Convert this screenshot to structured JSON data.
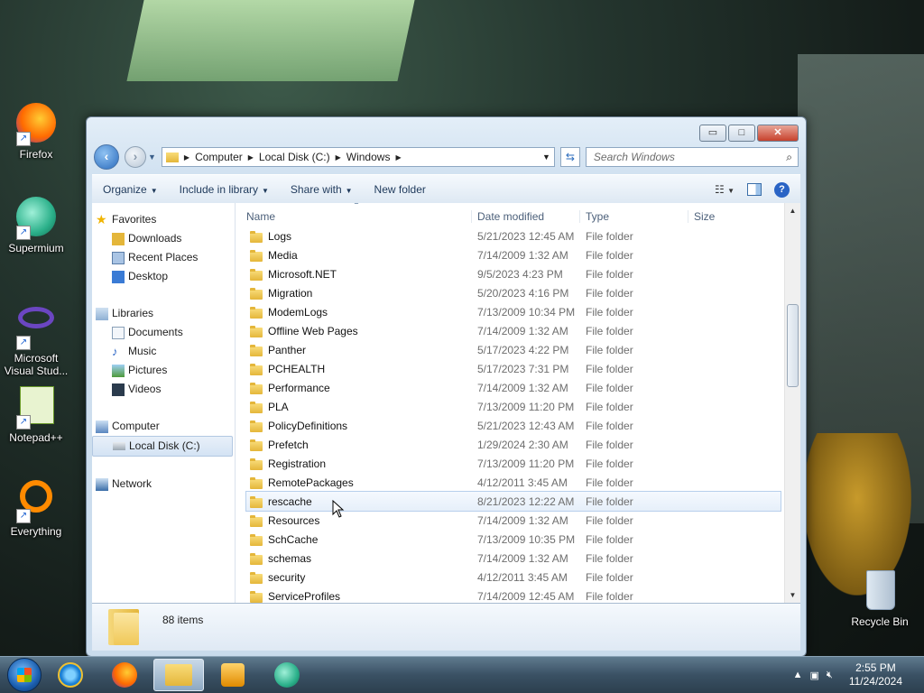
{
  "desktop": {
    "icons": [
      {
        "label": "Firefox",
        "icon": "firefox-icon"
      },
      {
        "label": "Supermium",
        "icon": "supermium-icon"
      },
      {
        "label": "Microsoft Visual Stud...",
        "icon": "visual-studio-icon"
      },
      {
        "label": "Notepad++",
        "icon": "notepad-plus-plus-icon"
      },
      {
        "label": "Everything",
        "icon": "everything-icon"
      },
      {
        "label": "Recycle Bin",
        "icon": "recycle-bin-icon"
      }
    ]
  },
  "window": {
    "caption_buttons": {
      "minimize": "▭",
      "maximize": "□",
      "close": "✕"
    },
    "address": {
      "segments": [
        "Computer",
        "Local Disk (C:)",
        "Windows"
      ]
    },
    "search": {
      "placeholder": "Search Windows"
    },
    "commands": [
      {
        "label": "Organize",
        "dropdown": true
      },
      {
        "label": "Include in library",
        "dropdown": true
      },
      {
        "label": "Share with",
        "dropdown": true
      },
      {
        "label": "New folder",
        "dropdown": false
      }
    ],
    "nav_pane": {
      "favorites": {
        "label": "Favorites",
        "items": [
          "Downloads",
          "Recent Places",
          "Desktop"
        ]
      },
      "libraries": {
        "label": "Libraries",
        "items": [
          "Documents",
          "Music",
          "Pictures",
          "Videos"
        ]
      },
      "computer": {
        "label": "Computer",
        "items": [
          "Local Disk (C:)"
        ]
      },
      "network": {
        "label": "Network"
      }
    },
    "columns": {
      "name": "Name",
      "date": "Date modified",
      "type": "Type",
      "size": "Size"
    },
    "files": [
      {
        "name": "Logs",
        "date": "5/21/2023 12:45 AM",
        "type": "File folder"
      },
      {
        "name": "Media",
        "date": "7/14/2009 1:32 AM",
        "type": "File folder"
      },
      {
        "name": "Microsoft.NET",
        "date": "9/5/2023 4:23 PM",
        "type": "File folder"
      },
      {
        "name": "Migration",
        "date": "5/20/2023 4:16 PM",
        "type": "File folder"
      },
      {
        "name": "ModemLogs",
        "date": "7/13/2009 10:34 PM",
        "type": "File folder"
      },
      {
        "name": "Offline Web Pages",
        "date": "7/14/2009 1:32 AM",
        "type": "File folder"
      },
      {
        "name": "Panther",
        "date": "5/17/2023 4:22 PM",
        "type": "File folder"
      },
      {
        "name": "PCHEALTH",
        "date": "5/17/2023 7:31 PM",
        "type": "File folder"
      },
      {
        "name": "Performance",
        "date": "7/14/2009 1:32 AM",
        "type": "File folder"
      },
      {
        "name": "PLA",
        "date": "7/13/2009 11:20 PM",
        "type": "File folder"
      },
      {
        "name": "PolicyDefinitions",
        "date": "5/21/2023 12:43 AM",
        "type": "File folder"
      },
      {
        "name": "Prefetch",
        "date": "1/29/2024 2:30 AM",
        "type": "File folder"
      },
      {
        "name": "Registration",
        "date": "7/13/2009 11:20 PM",
        "type": "File folder"
      },
      {
        "name": "RemotePackages",
        "date": "4/12/2011 3:45 AM",
        "type": "File folder"
      },
      {
        "name": "rescache",
        "date": "8/21/2023 12:22 AM",
        "type": "File folder"
      },
      {
        "name": "Resources",
        "date": "7/14/2009 1:32 AM",
        "type": "File folder"
      },
      {
        "name": "SchCache",
        "date": "7/13/2009 10:35 PM",
        "type": "File folder"
      },
      {
        "name": "schemas",
        "date": "7/14/2009 1:32 AM",
        "type": "File folder"
      },
      {
        "name": "security",
        "date": "4/12/2011 3:45 AM",
        "type": "File folder"
      },
      {
        "name": "ServiceProfiles",
        "date": "7/14/2009 12:45 AM",
        "type": "File folder"
      }
    ],
    "hover_row": "rescache",
    "status": {
      "count": "88 items"
    }
  },
  "taskbar": {
    "buttons": [
      "start-button",
      "internet-explorer-icon",
      "firefox-icon",
      "windows-explorer-icon",
      "media-player-icon",
      "supermium-icon"
    ],
    "active": "windows-explorer-icon",
    "clock": {
      "time": "2:55 PM",
      "date": "11/24/2024"
    }
  }
}
